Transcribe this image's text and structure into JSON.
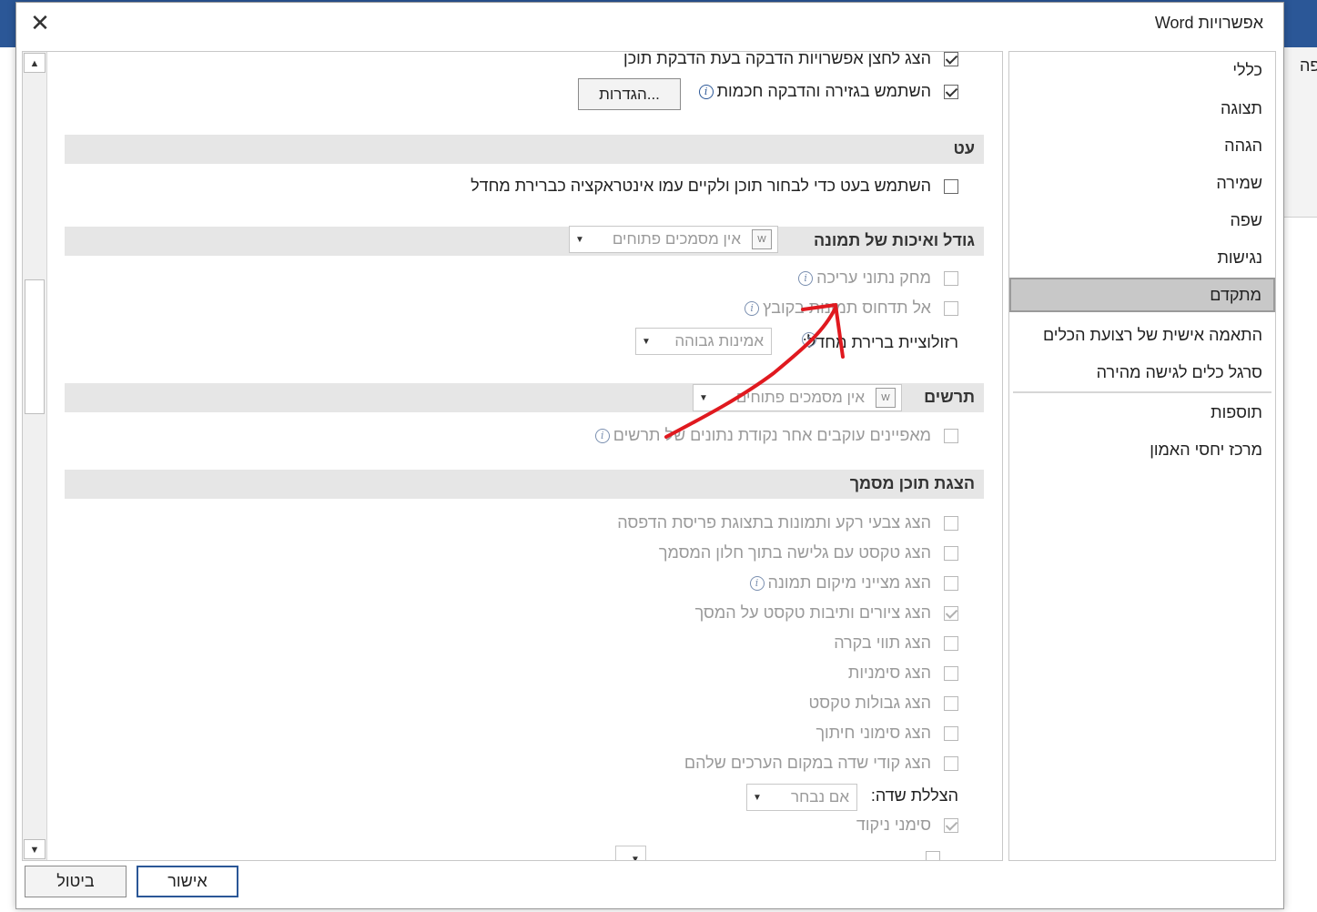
{
  "dialog": {
    "title": "אפשרויות Word",
    "close_glyph": "✕",
    "ok_label": "אישור",
    "cancel_label": "ביטול"
  },
  "background": {
    "partial_glyph": "פה"
  },
  "nav": {
    "items": [
      {
        "label": "כללי"
      },
      {
        "label": "תצוגה"
      },
      {
        "label": "הגהה"
      },
      {
        "label": "שמירה"
      },
      {
        "label": "שפה"
      },
      {
        "label": "נגישות"
      },
      {
        "label": "מתקדם",
        "selected": true
      },
      {
        "label": "התאמה אישית של רצועת הכלים"
      },
      {
        "label": "סרגל כלים לגישה מהירה"
      },
      {
        "label": "תוספות"
      },
      {
        "label": "מרכז יחסי האמון"
      }
    ]
  },
  "scroll": {
    "up": "▲",
    "down": "▼"
  },
  "content": {
    "paste_options_row": {
      "label": "הצג לחצן אפשרויות הדבקה בעת הדבקת תוכן",
      "checked": true
    },
    "smart_cut_row": {
      "label": "השתמש בגזירה והדבקה חכמות",
      "checked": true
    },
    "settings_button": "הגדרות...",
    "pen": {
      "title": "עט",
      "use_pen_row": {
        "label": "השתמש בעט כדי לבחור תוכן ולקיים עמו אינטראקציה כברירת מחדל",
        "checked": false
      }
    },
    "image_size": {
      "title": "גודל ואיכות של תמונה",
      "doc_dropdown": "אין מסמכים פתוחים",
      "discard_edit_row": {
        "label": "מחק נתוני עריכה",
        "checked": false
      },
      "no_compress_row": {
        "label": "אל תדחוס תמונות בקובץ",
        "checked": false
      },
      "resolution_label": "רזולוציית ברירת מחדל:",
      "resolution_value": "אמינות גבוהה"
    },
    "chart": {
      "title": "תרשים",
      "doc_dropdown": "אין מסמכים פתוחים",
      "props_follow_row": {
        "label": "מאפיינים עוקבים אחר נקודת נתונים של תרשים",
        "checked": false
      }
    },
    "display": {
      "title": "הצגת תוכן מסמך",
      "rows": [
        {
          "label": "הצג צבעי רקע ותמונות בתצוגת פריסת הדפסה",
          "checked": false
        },
        {
          "label": "הצג טקסט עם גלישה בתוך חלון המסמך",
          "checked": false
        },
        {
          "label": "הצג מצייני מיקום תמונה",
          "checked": false,
          "info": true
        },
        {
          "label": "הצג ציורים ותיבות טקסט על המסך",
          "checked": true
        },
        {
          "label": "הצג תווי בקרה",
          "checked": false
        },
        {
          "label": "הצג סימניות",
          "checked": false
        },
        {
          "label": "הצג גבולות טקסט",
          "checked": false
        },
        {
          "label": "הצג סימוני חיתוך",
          "checked": false
        },
        {
          "label": "הצג קודי שדה במקום הערכים שלהם",
          "checked": false
        }
      ],
      "field_shading_label": "הצללת שדה:",
      "field_shading_value": "אם נבחר",
      "vowel_marks_row": {
        "label": "סימני ניקוד",
        "checked": true
      }
    },
    "info_glyph": "i",
    "doc_icon_glyph": "W",
    "dropdown_arrow": "▼"
  },
  "colors": {
    "accent": "#2b5797",
    "selected_nav": "#c8c8c8",
    "section_bar": "#e6e6e6",
    "annotation": "#e0191f"
  }
}
